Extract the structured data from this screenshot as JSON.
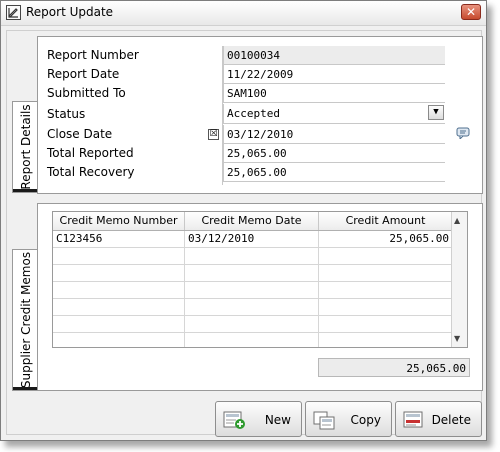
{
  "window": {
    "title": "Report Update"
  },
  "tabs": {
    "report_details": "Report Details",
    "supplier_credit_memos": "Supplier Credit Memos"
  },
  "report": {
    "fields": [
      {
        "label": "Report Number",
        "value": "00100034"
      },
      {
        "label": "Report Date",
        "value": "11/22/2009"
      },
      {
        "label": "Submitted To",
        "value": "SAM100"
      },
      {
        "label": "Status",
        "value": "Accepted"
      },
      {
        "label": "Close Date",
        "value": "03/12/2010",
        "checkbox": "☒"
      },
      {
        "label": "Total Reported",
        "value": "25,065.00"
      },
      {
        "label": "Total Recovery",
        "value": "25,065.00"
      }
    ]
  },
  "memos": {
    "columns": [
      "Credit Memo Number",
      "Credit Memo Date",
      "Credit Amount"
    ],
    "rows": [
      {
        "number": "C123456",
        "date": "03/12/2010",
        "amount": "25,065.00"
      }
    ],
    "total": "25,065.00"
  },
  "buttons": {
    "new": "New",
    "copy": "Copy",
    "delete": "Delete"
  },
  "icons": {
    "app": "window-app-icon",
    "close": "close-icon",
    "dropdown": "chevron-down-icon",
    "side": "comment-icon",
    "new": "new-document-icon",
    "copy": "copy-icon",
    "delete": "delete-icon"
  },
  "colors": {
    "close_button": "#c64a2e",
    "new_icon_accent": "#2e9a2e",
    "delete_icon_accent": "#c83232"
  }
}
